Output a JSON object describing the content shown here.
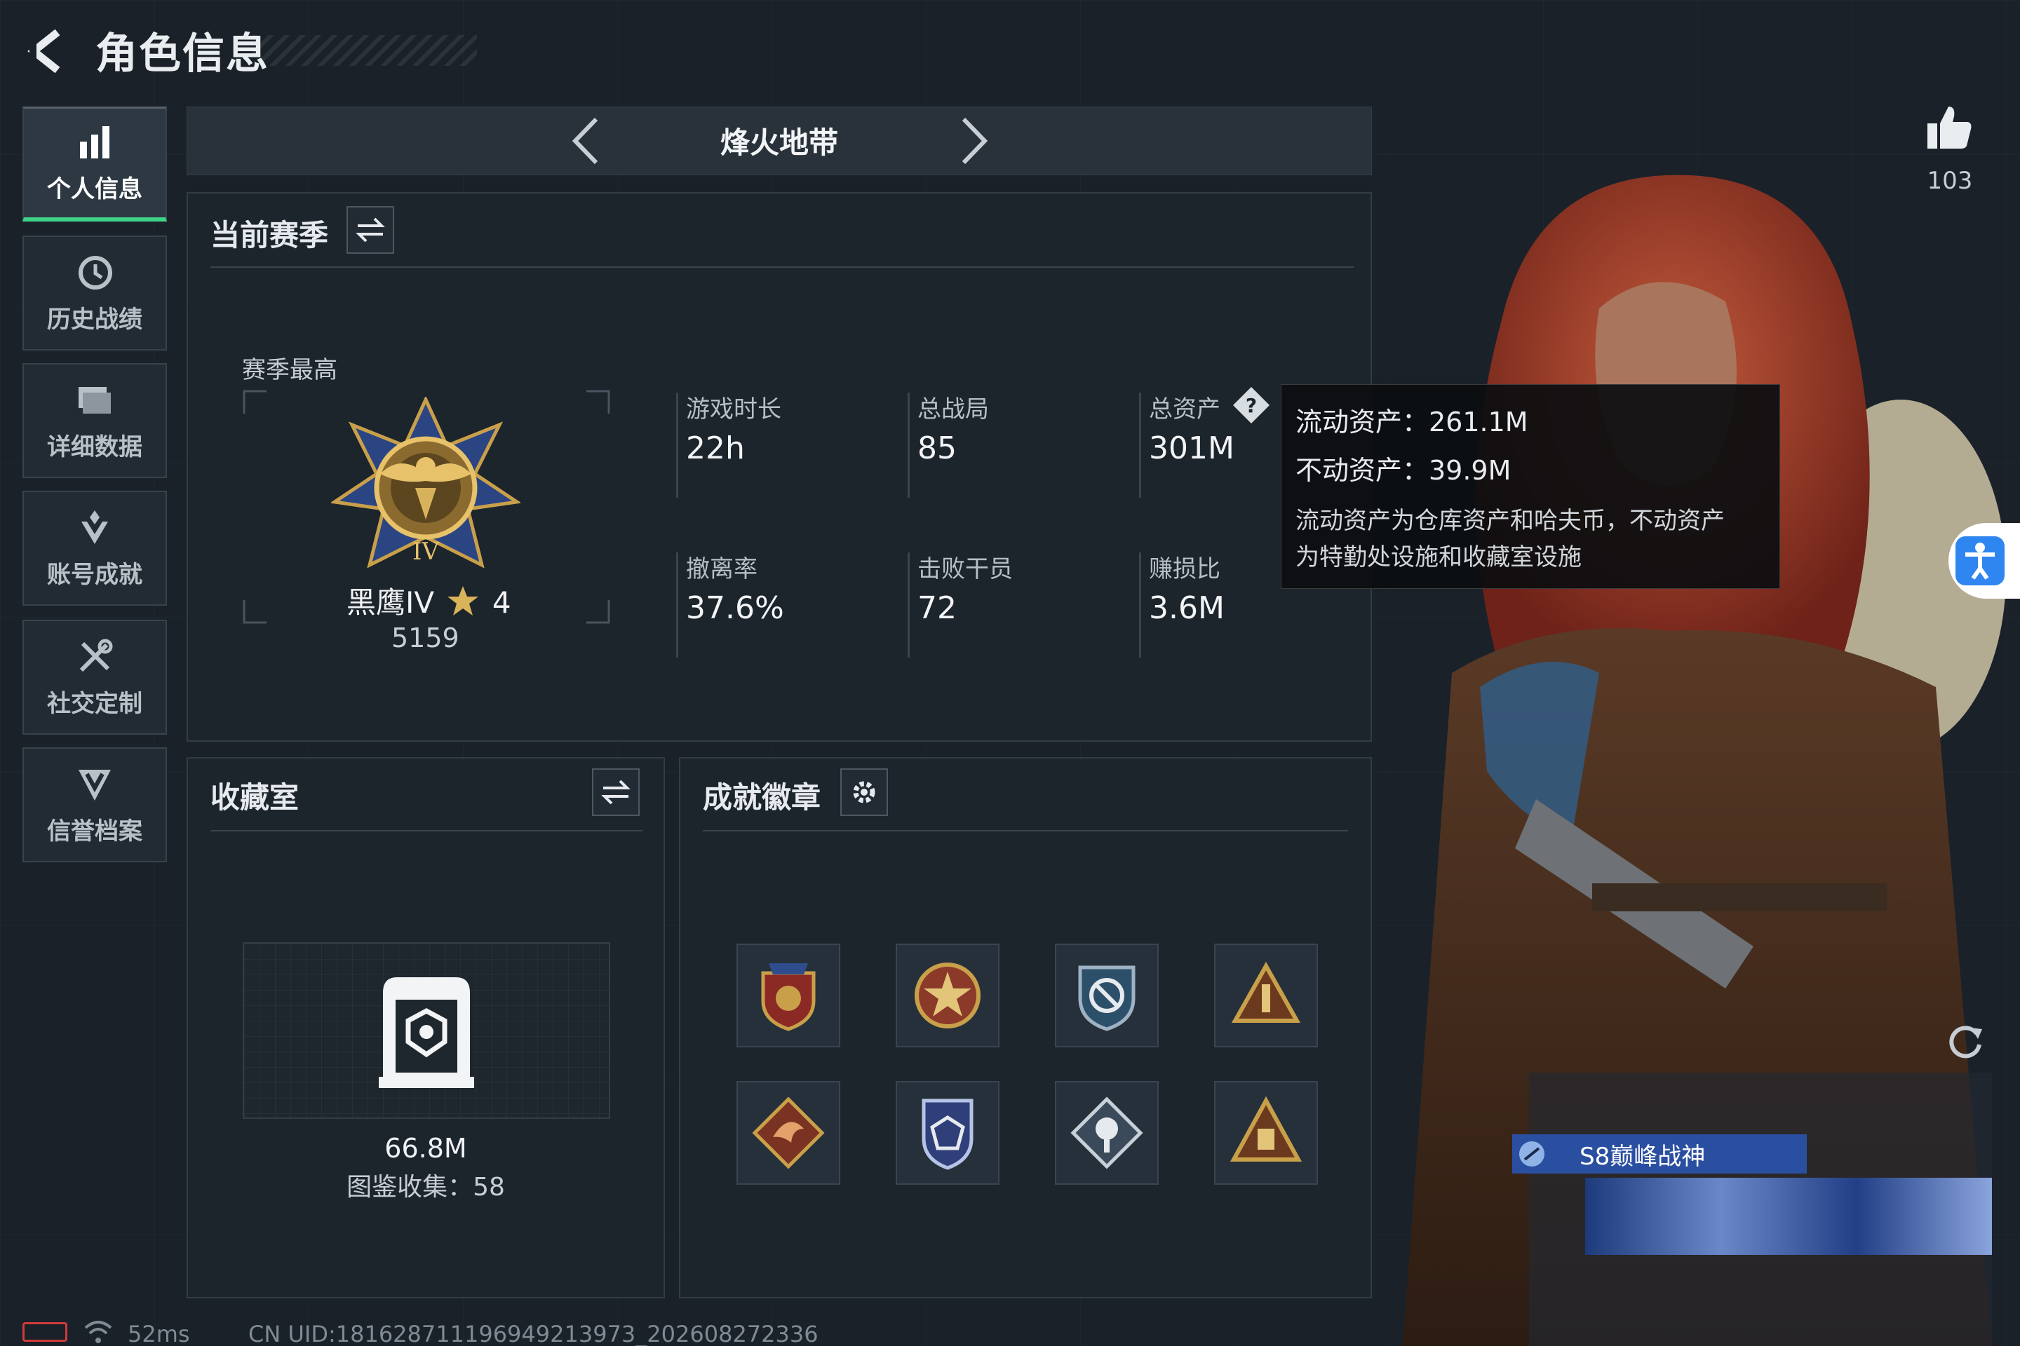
{
  "header": {
    "title": "角色信息"
  },
  "sidebar": {
    "items": [
      {
        "label": "个人信息",
        "icon": "bar-chart-icon",
        "active": true
      },
      {
        "label": "历史战绩",
        "icon": "history-clock-icon",
        "active": false
      },
      {
        "label": "详细数据",
        "icon": "folder-icon",
        "active": false
      },
      {
        "label": "账号成就",
        "icon": "achievement-icon",
        "active": false
      },
      {
        "label": "社交定制",
        "icon": "tools-icon",
        "active": false
      },
      {
        "label": "信誉档案",
        "icon": "shield-v-icon",
        "active": false
      }
    ]
  },
  "mode": {
    "title": "烽火地带"
  },
  "likes": {
    "count": "103",
    "icon": "thumbs-up-icon"
  },
  "season": {
    "title": "当前赛季",
    "best_label": "赛季最高",
    "rank_name": "黑鹰IV",
    "rank_stars": "4",
    "rank_score": "5159",
    "stats": [
      {
        "label": "游戏时长",
        "value": "22h"
      },
      {
        "label": "总战局",
        "value": "85"
      },
      {
        "label": "总资产",
        "value": "301M"
      },
      {
        "label": "撤离率",
        "value": "37.6%"
      },
      {
        "label": "击败干员",
        "value": "72"
      },
      {
        "label": "赚损比",
        "value": "3.6M"
      }
    ]
  },
  "tooltip": {
    "liquid": "流动资产：261.1M",
    "fixed": "不动资产：39.9M",
    "desc_line1": "流动资产为仓库资产和哈夫币，不动资产",
    "desc_line2": "为特勤处设施和收藏室设施"
  },
  "collection": {
    "title": "收藏室",
    "value": "66.8M",
    "catalog": "图鉴收集：58"
  },
  "badges": {
    "title": "成就徽章",
    "items": [
      "shield-crest-badge",
      "star-medal-badge",
      "blue-shield-badge",
      "pyramid-badge",
      "dragon-diamond-badge",
      "blue-crest-badge",
      "diamond-flower-badge",
      "tower-badge"
    ]
  },
  "character": {
    "tag": "S8巅峰战神"
  },
  "footer": {
    "ping": "52ms",
    "uid": "CN UID:181628711196949213973_202608272336"
  },
  "colors": {
    "accent_green": "#3fd38a",
    "panel": "#1c242c",
    "gold": "#c9a04a",
    "info_blue": "#2f86f0"
  }
}
